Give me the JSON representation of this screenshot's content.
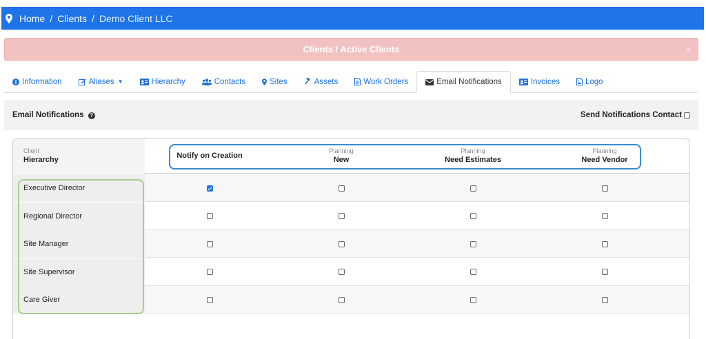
{
  "breadcrumb": {
    "home": "Home",
    "sep1": "/",
    "clients": "Clients",
    "sep2": "/",
    "current": "Demo Client LLC"
  },
  "alert": {
    "text": "Clients / Active Clients",
    "close": "×"
  },
  "tabs": [
    {
      "label": "Information",
      "icon": "info-circle-icon"
    },
    {
      "label": "Aliases",
      "icon": "edit-icon",
      "caret": "▼"
    },
    {
      "label": "Hierarchy",
      "icon": "id-card-icon"
    },
    {
      "label": "Contacts",
      "icon": "users-icon"
    },
    {
      "label": "Sites",
      "icon": "map-marker-icon"
    },
    {
      "label": "Assets",
      "icon": "gavel-icon"
    },
    {
      "label": "Work Orders",
      "icon": "document-icon"
    },
    {
      "label": "Email Notifications",
      "icon": "envelope-icon",
      "active": true
    },
    {
      "label": "Invoices",
      "icon": "id-card-icon"
    },
    {
      "label": "Logo",
      "icon": "image-file-icon"
    }
  ],
  "panel": {
    "title": "Email Notifications",
    "help": "?",
    "send_label": "Send Notifications Contact",
    "send_checked": false
  },
  "table": {
    "first_header": {
      "small": "Client",
      "big": "Hierarchy"
    },
    "columns": [
      {
        "small": "",
        "big": "Notify on Creation"
      },
      {
        "small": "Planning",
        "big": "New"
      },
      {
        "small": "Planning",
        "big": "Need Estimates"
      },
      {
        "small": "Planning",
        "big": "Need Vendor"
      }
    ],
    "rows": [
      {
        "label": "Executive Director",
        "checks": [
          true,
          false,
          false,
          false
        ]
      },
      {
        "label": "Regional Director",
        "checks": [
          false,
          false,
          false,
          false
        ]
      },
      {
        "label": "Site Manager",
        "checks": [
          false,
          false,
          false,
          false
        ]
      },
      {
        "label": "Site Supervisor",
        "checks": [
          false,
          false,
          false,
          false
        ]
      },
      {
        "label": "Care Giver",
        "checks": [
          false,
          false,
          false,
          false
        ]
      }
    ]
  },
  "colors": {
    "topbar": "#1e74e8",
    "alert_bg": "#f2c2c2",
    "link": "#1e6fd9",
    "highlight_blue": "#3a8bd1",
    "highlight_green": "#a6cf8a"
  }
}
